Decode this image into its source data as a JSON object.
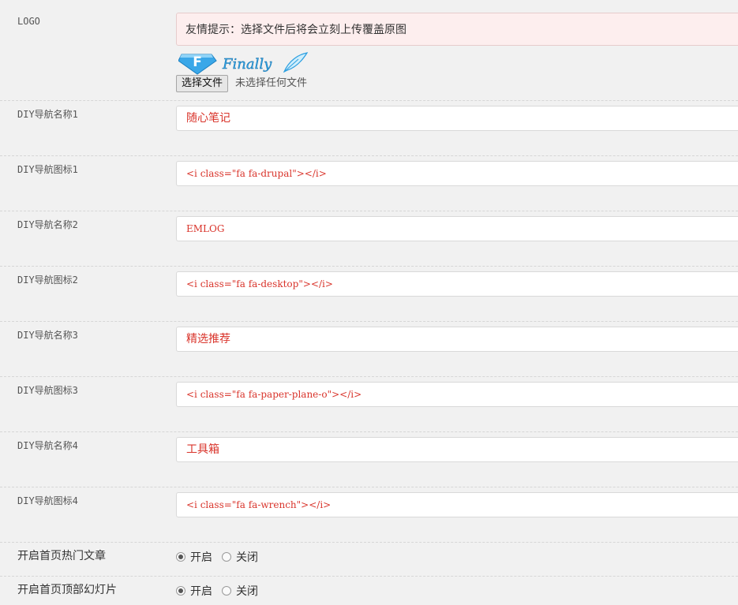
{
  "logo": {
    "label": "LOGO",
    "notice": "友情提示：选择文件后将会立刻上传覆盖原图",
    "logo_letter": "F",
    "logo_text": "Finally",
    "file_button": "选择文件",
    "file_status": "未选择任何文件"
  },
  "fields": [
    {
      "label": "DIY导航名称1",
      "value": "随心笔记"
    },
    {
      "label": "DIY导航图标1",
      "value": "<i class=\"fa fa-drupal\"></i>"
    },
    {
      "label": "DIY导航名称2",
      "value": "EMLOG"
    },
    {
      "label": "DIY导航图标2",
      "value": "<i class=\"fa fa-desktop\"></i>"
    },
    {
      "label": "DIY导航名称3",
      "value": "精选推荐"
    },
    {
      "label": "DIY导航图标3",
      "value": "<i class=\"fa fa-paper-plane-o\"></i>"
    },
    {
      "label": "DIY导航名称4",
      "value": "工具箱"
    },
    {
      "label": "DIY导航图标4",
      "value": "<i class=\"fa fa-wrench\"></i>"
    }
  ],
  "toggles": [
    {
      "label": "开启首页热门文章",
      "on_label": "开启",
      "off_label": "关闭",
      "selected": "on"
    },
    {
      "label": "开启首页顶部幻灯片",
      "on_label": "开启",
      "off_label": "关闭",
      "selected": "on"
    }
  ],
  "colors": {
    "field_text": "#d9342b",
    "notice_bg": "#fdeeee",
    "logo_blue": "#2c9fe0"
  }
}
